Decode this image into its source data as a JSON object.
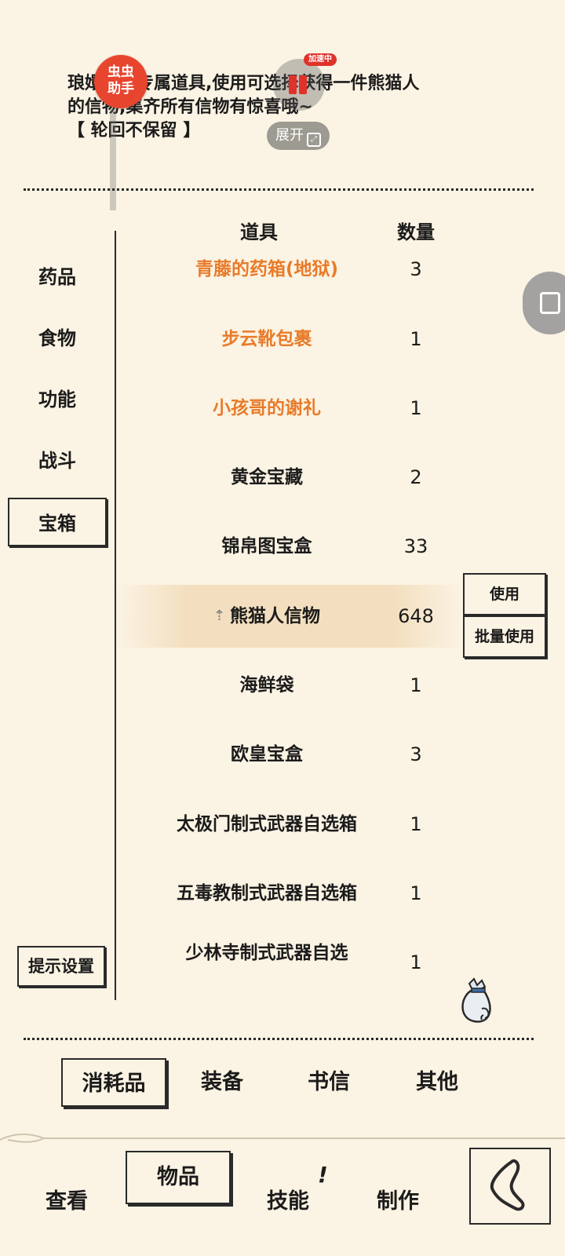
{
  "description": {
    "line1": "琅嬛福地专属道具,使用可选择获得一件熊猫人",
    "line2": "的信物,集齐所有信物有惊喜哦~",
    "line3": "【 轮回不保留 】"
  },
  "overlay": {
    "chongchong_line1": "虫虫",
    "chongchong_line2": "助手",
    "speed_badge": "加速中",
    "expand_label": "展开"
  },
  "categories": [
    "药品",
    "食物",
    "功能",
    "战斗",
    "宝箱"
  ],
  "active_category": "宝箱",
  "tip_settings": "提示设置",
  "table": {
    "header_item": "道具",
    "header_qty": "数量",
    "rows": [
      {
        "name": "青藤的药箱(地狱)",
        "qty": "3",
        "highlight": "orange"
      },
      {
        "name": "步云靴包裹",
        "qty": "1",
        "highlight": "orange"
      },
      {
        "name": "小孩哥的谢礼",
        "qty": "1",
        "highlight": "orange"
      },
      {
        "name": "黄金宝藏",
        "qty": "2"
      },
      {
        "name": "锦帛图宝盒",
        "qty": "33"
      },
      {
        "name": "熊猫人信物",
        "qty": "648",
        "selected": true
      },
      {
        "name": "海鲜袋",
        "qty": "1"
      },
      {
        "name": "欧皇宝盒",
        "qty": "3"
      },
      {
        "name": "太极门制式武器自选箱",
        "qty": "1"
      },
      {
        "name": "五毒教制式武器自选箱",
        "qty": "1"
      },
      {
        "name": "少林寺制式武器自选",
        "qty": "1"
      }
    ]
  },
  "actions": {
    "use": "使用",
    "batch_use": "批量使用"
  },
  "bag_tabs": [
    "消耗品",
    "装备",
    "书信",
    "其他"
  ],
  "nav_tabs": [
    "查看",
    "物品",
    "技能",
    "制作"
  ],
  "skill_mark": "!",
  "colors": {
    "background": "#fbf3e3",
    "accent_orange": "#e87b2a",
    "ink": "#1b1b1b"
  },
  "icons": [
    "bag-icon",
    "back-arrow-icon",
    "pin-top-icon",
    "expand-icon",
    "side-float-icon"
  ]
}
